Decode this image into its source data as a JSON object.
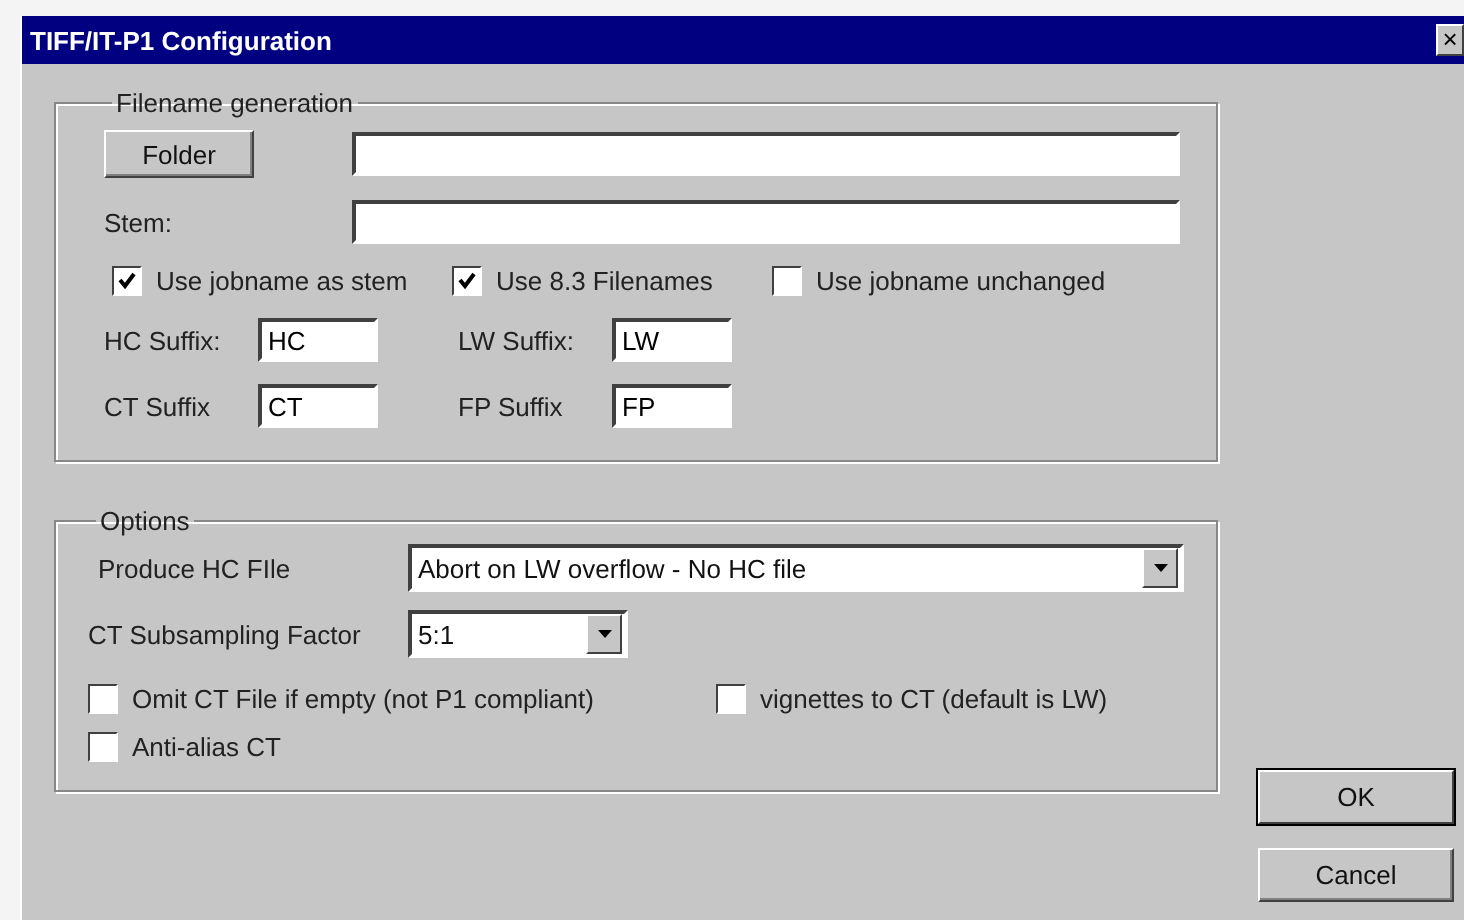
{
  "window": {
    "title": "TIFF/IT-P1 Configuration",
    "close": "×"
  },
  "filename_group": {
    "title": "Filename generation",
    "folder_button": "Folder",
    "stem_label": "Stem:",
    "checkboxes": [
      {
        "label": "Use jobname as stem",
        "checked": true
      },
      {
        "label": "Use 8.3 Filenames",
        "checked": true
      },
      {
        "label": "Use jobname unchanged",
        "checked": false
      }
    ],
    "suffixes": [
      {
        "label": "HC Suffix:",
        "value": "HC"
      },
      {
        "label": "LW Suffix:",
        "value": "LW"
      },
      {
        "label": "CT Suffix",
        "value": "CT"
      },
      {
        "label": "FP Suffix",
        "value": "FP"
      }
    ]
  },
  "options_group": {
    "title": "Options",
    "selects": [
      {
        "label": "Produce HC FIle",
        "value": "Abort on LW overflow - No HC file",
        "kind": "wide"
      },
      {
        "label": "CT Subsampling Factor",
        "value": "5:1",
        "kind": "narrow"
      }
    ],
    "checkboxes": [
      {
        "label": "Omit CT File if empty (not P1 compliant)",
        "checked": false
      },
      {
        "label": "vignettes to CT (default is LW)",
        "checked": false
      },
      {
        "label": "Anti-alias CT",
        "checked": false
      }
    ]
  },
  "buttons": [
    {
      "label": "OK",
      "default": true
    },
    {
      "label": "Cancel",
      "default": false
    }
  ]
}
